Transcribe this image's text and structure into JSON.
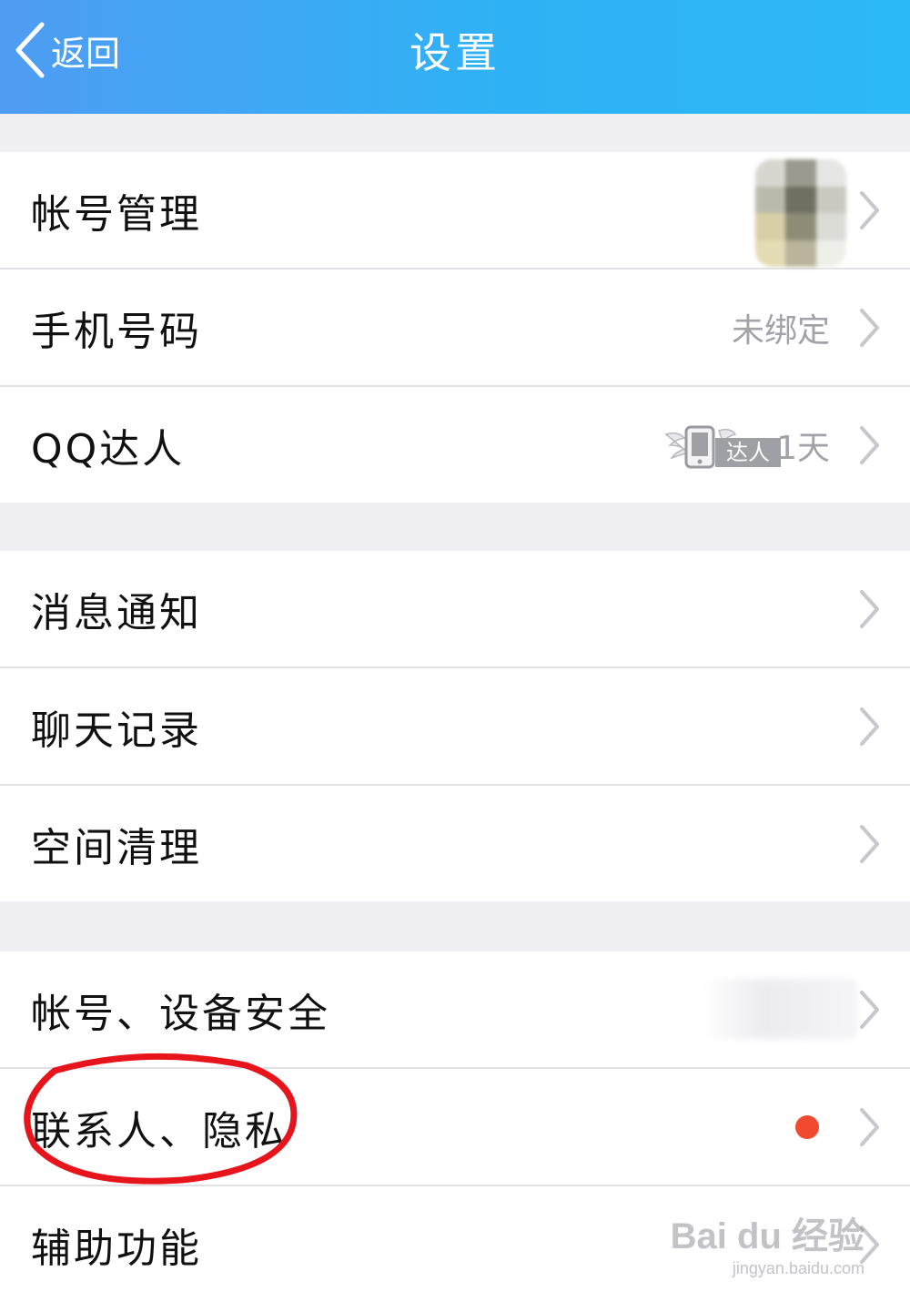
{
  "header": {
    "back_label": "返回",
    "title": "设置",
    "gradient": [
      "#4f9cf3",
      "#2db8f7"
    ]
  },
  "sections": [
    {
      "items": [
        {
          "label": "帐号管理",
          "value": "",
          "trailing": "blurred-avatar"
        },
        {
          "label": "手机号码",
          "value": "未绑定"
        },
        {
          "label": "QQ达人",
          "badge_text": "达人",
          "value": "1天"
        }
      ]
    },
    {
      "items": [
        {
          "label": "消息通知"
        },
        {
          "label": "聊天记录"
        },
        {
          "label": "空间清理"
        }
      ]
    },
    {
      "items": [
        {
          "label": "帐号、设备安全",
          "trailing": "blurred-status"
        },
        {
          "label": "联系人、隐私",
          "trailing": "red-dot",
          "highlighted": true
        },
        {
          "label": "辅助功能"
        }
      ]
    }
  ],
  "watermark": {
    "main": "Bai du 经验",
    "sub": "jingyan.baidu.com"
  },
  "colors": {
    "background": "#f0f0f4",
    "chevron": "#c7c7cc",
    "red_dot": "#f04b2f",
    "annotation_circle": "#e8141c"
  }
}
